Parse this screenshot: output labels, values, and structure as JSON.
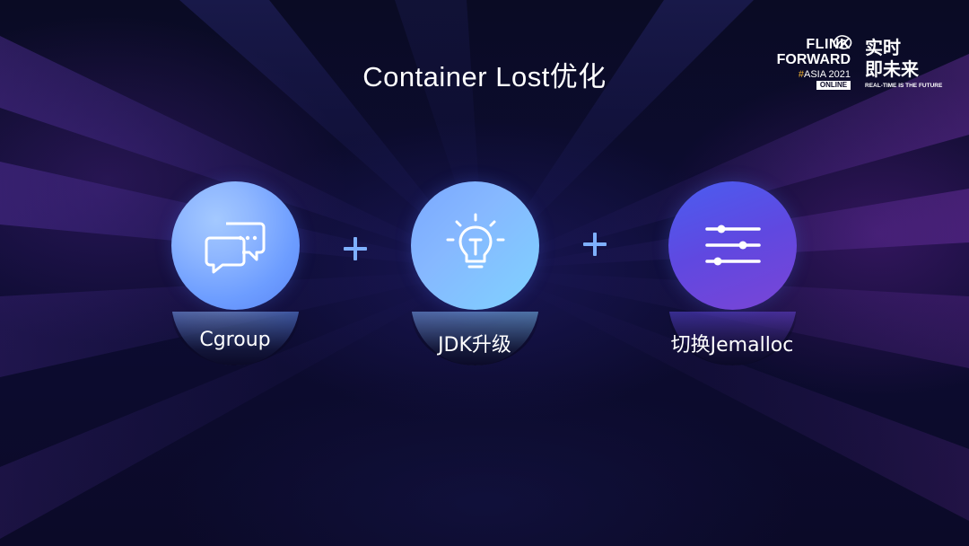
{
  "slide": {
    "title": "Container Lost优化"
  },
  "logo": {
    "line1": "FLINK",
    "line2": "FORWARD",
    "hash": "#",
    "event": "ASIA 2021",
    "badge": "ONLINE",
    "cn_line1": "实时",
    "cn_line2": "即未来",
    "tagline": "REAL-TIME IS THE FUTURE"
  },
  "features": [
    {
      "label": "Cgroup",
      "icon": "chat-bubbles-icon"
    },
    {
      "label": "JDK升级",
      "icon": "lightbulb-icon"
    },
    {
      "label": "切换Jemalloc",
      "icon": "sliders-icon"
    }
  ],
  "operators": [
    "plus-icon",
    "plus-icon"
  ],
  "colors": {
    "background": "#0b0a28",
    "circle1": "#8fb7ff",
    "circle2": "#86b8ff",
    "circle3": "#6048e0",
    "plus": "#7eb0ff",
    "accent_hash": "#f2b233"
  }
}
